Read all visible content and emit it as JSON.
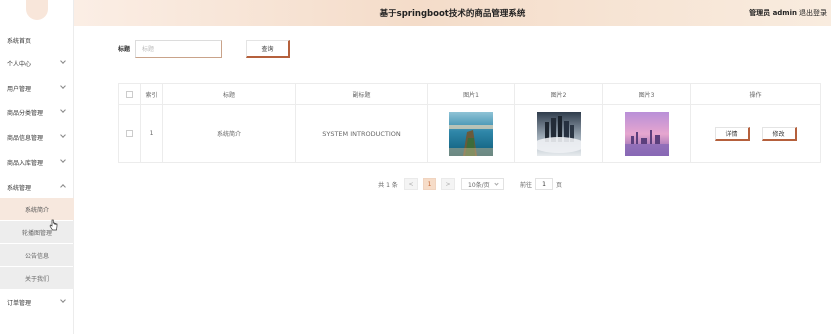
{
  "header": {
    "title": "基于springboot技术的商品管理系统",
    "user": "管理员 admin",
    "logout": "退出登录"
  },
  "sidebar": {
    "items": [
      {
        "label": "系统首页"
      },
      {
        "label": "个人中心"
      },
      {
        "label": "用户管理"
      },
      {
        "label": "商品分类管理"
      },
      {
        "label": "商品信息管理"
      },
      {
        "label": "商品入库管理"
      },
      {
        "label": "系统管理"
      }
    ],
    "sub_items": [
      {
        "label": "系统简介"
      },
      {
        "label": "轮播图管理"
      },
      {
        "label": "公告信息"
      },
      {
        "label": "关于我们"
      }
    ],
    "bottom_item": {
      "label": "订单管理"
    }
  },
  "search": {
    "label": "标题",
    "placeholder": "标题",
    "button": "查询"
  },
  "table": {
    "columns": [
      "",
      "索引",
      "标题",
      "副标题",
      "图片1",
      "图片2",
      "图片3",
      "操作"
    ],
    "rows": [
      {
        "index": "1",
        "title": "系统简介",
        "subtitle": "SYSTEM INTRODUCTION",
        "detail": "详情",
        "edit": "修改"
      }
    ]
  },
  "pagination": {
    "total": "共 1 条",
    "prev": "<",
    "current": "1",
    "next": ">",
    "page_size": "10条/页",
    "goto_label": "前往",
    "goto_value": "1",
    "page_unit": "页"
  }
}
